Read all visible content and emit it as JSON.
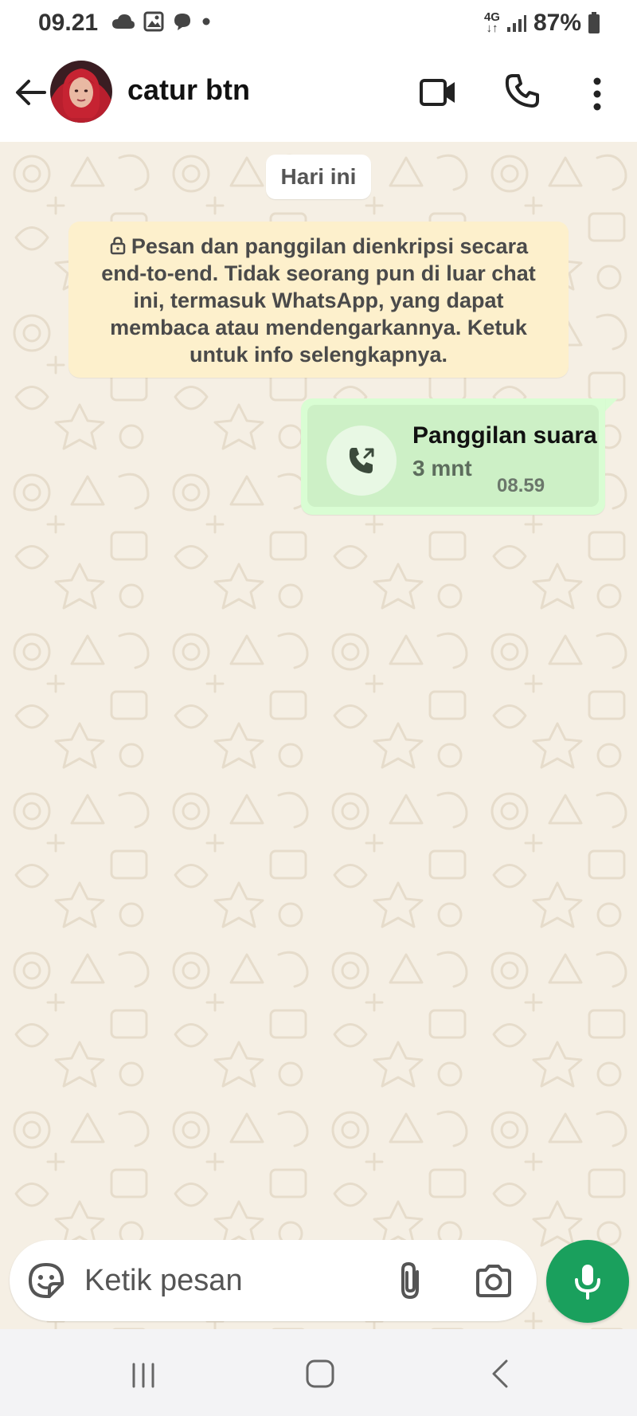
{
  "status_bar": {
    "time": "09.21",
    "network_top": "4G",
    "network_bottom": "↓↑",
    "battery": "87%",
    "icons": [
      "cloud-icon",
      "gallery-icon",
      "chat-bubble-icon",
      "dot-icon",
      "signal-icon",
      "battery-icon"
    ]
  },
  "header": {
    "contact_name": "catur btn",
    "icons": [
      "back-arrow-icon",
      "avatar",
      "video-call-icon",
      "voice-call-icon",
      "more-vert-icon"
    ]
  },
  "chat": {
    "date_chip": "Hari ini",
    "encryption_notice": "Pesan dan panggilan dienkripsi secara end-to-end. Tidak seorang pun di luar chat ini, termasuk WhatsApp, yang dapat membaca atau mendengarkannya. Ketuk untuk info selengkapnya.",
    "messages": [
      {
        "type": "voice-call",
        "title": "Panggilan suara",
        "duration": "3 mnt",
        "time": "08.59",
        "icon": "outgoing-call-icon"
      }
    ]
  },
  "composer": {
    "placeholder": "Ketik pesan",
    "icons": [
      "sticker-icon",
      "paperclip-icon",
      "camera-icon",
      "mic-icon"
    ]
  },
  "colors": {
    "chat_background": "#f5efe4",
    "outgoing_bubble": "#d9fdd3",
    "encryption_note": "#fdf0cc",
    "accent_green": "#1aa05d",
    "header_background": "#ffffff"
  },
  "nav_bar": {
    "icons": [
      "recents-icon",
      "home-icon",
      "back-icon"
    ]
  }
}
